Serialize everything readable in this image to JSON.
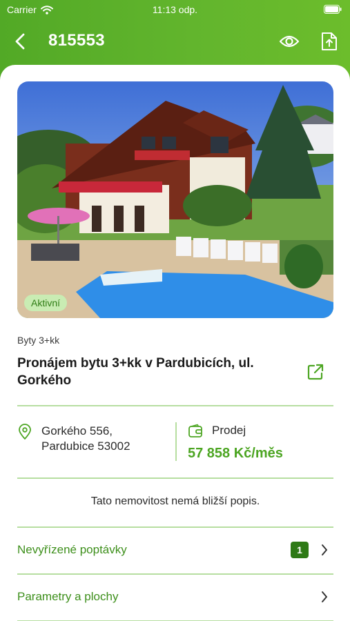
{
  "status_bar": {
    "carrier": "Carrier",
    "time": "11:13 odp."
  },
  "navbar": {
    "title": "815553",
    "icons": [
      "back-arrow-icon",
      "eye-icon",
      "file-export-icon"
    ]
  },
  "listing": {
    "badge": "Aktivní",
    "category": "Byty 3+kk",
    "title": "Pronájem bytu 3+kk v Pardubicích, ul. Gorkého",
    "address_line1": "Gorkého 556,",
    "address_line2": "Pardubice 53002",
    "deal_type": "Prodej",
    "price": "57 858 Kč/měs",
    "description": "Tato nemovitost nemá bližší popis."
  },
  "rows": [
    {
      "label": "Nevyřízené poptávky",
      "count": "1"
    },
    {
      "label": "Parametry a plochy"
    }
  ],
  "colors": {
    "brand_green": "#5cb22b",
    "accent_text": "#3d8f1b",
    "price": "#4ca522",
    "badge_bg": "#c9ecb3",
    "divider": "#b6dea0"
  }
}
